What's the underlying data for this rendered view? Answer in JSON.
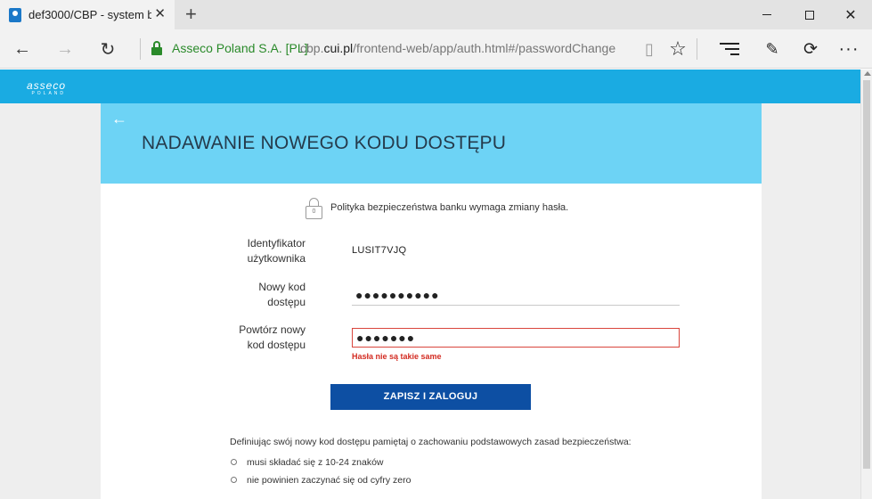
{
  "browser": {
    "tab_title": "def3000/CBP - system b",
    "cert_name": "Asseco Poland S.A. [PL]",
    "url_prefix": "cbp.",
    "url_domain": "cui.pl",
    "url_path": "/frontend-web/app/auth.html#/passwordChange",
    "new_tab_icon": "plus-icon",
    "icons": [
      "back-arrow-icon",
      "forward-arrow-icon",
      "refresh-icon",
      "lock-icon",
      "reading-view-icon",
      "favorite-star-icon",
      "hub-icon",
      "web-note-icon",
      "share-icon",
      "more-icon"
    ]
  },
  "brand": {
    "logo_text": "asseco",
    "logo_sub": "POLAND",
    "band_color": "#1aabe2"
  },
  "header": {
    "title": "NADAWANIE NOWEGO KODU DOSTĘPU",
    "color": "#6dd3f5"
  },
  "policy": {
    "padlock_digit": "0",
    "text": "Polityka bezpieczeństwa banku wymaga zmiany hasła."
  },
  "form": {
    "user_label_line1": "Identyfikator",
    "user_label_line2": "użytkownika",
    "user_value": "LUSIT7VJQ",
    "new_label_line1": "Nowy kod",
    "new_label_line2": "dostępu",
    "new_value": "●●●●●●●●●●",
    "repeat_label_line1": "Powtórz nowy",
    "repeat_label_line2": "kod dostępu",
    "repeat_value": "●●●●●●●",
    "error": "Hasła nie są takie same",
    "error_color": "#d32b21"
  },
  "submit": {
    "label": "ZAPISZ I ZALOGUJ",
    "color": "#0d4fa3"
  },
  "rules": {
    "intro": "Definiując swój nowy kod dostępu pamiętaj o zachowaniu podstawowych zasad bezpieczeństwa:",
    "items": [
      "musi składać się z 10-24 znaków",
      "nie powinien zaczynać się od cyfry zero"
    ]
  }
}
